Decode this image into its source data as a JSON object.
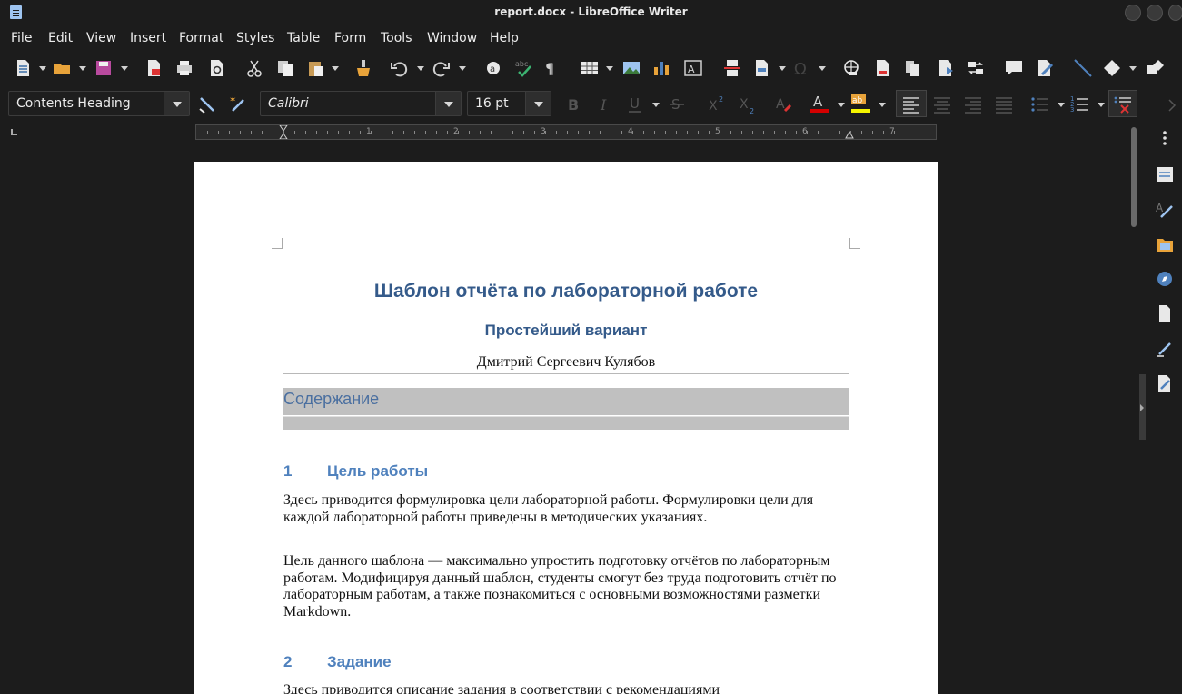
{
  "window": {
    "title": "report.docx - LibreOffice Writer"
  },
  "menu": [
    "File",
    "Edit",
    "View",
    "Insert",
    "Format",
    "Styles",
    "Table",
    "Form",
    "Tools",
    "Window",
    "Help"
  ],
  "toolbar": {
    "paragraph_style": "Contents Heading",
    "font_name": "Calibri",
    "font_size": "16 pt"
  },
  "ruler": {
    "numbers": [
      "1",
      "2",
      "3",
      "4",
      "5",
      "6",
      "7"
    ]
  },
  "document": {
    "title": "Шаблон отчёта по лабораторной работе",
    "subtitle": "Простейший вариант",
    "author": "Дмитрий Сергеевич Кулябов",
    "toc_heading": "Содержание",
    "sections": [
      {
        "number": "1",
        "heading": "Цель работы",
        "paragraphs": [
          "Здесь приводится формулировка цели лабораторной работы. Формулировки цели для каждой лабораторной работы приведены в методических указаниях.",
          "Цель данного шаблона — максимально упростить подготовку отчётов по лабораторным работам. Модифицируя данный шаблон, студенты смогут без труда подготовить отчёт по лабораторным работам, а также познакомиться с основными возможностями разметки Markdown."
        ]
      },
      {
        "number": "2",
        "heading": "Задание",
        "paragraphs": [
          "Здесь приводится описание задания в соответствии с рекомендациями"
        ]
      }
    ]
  },
  "colors": {
    "heading": "#345a8a",
    "section_heading": "#4f81bd",
    "toc_highlight": "#c0c0c0",
    "chrome": "#1c1c1c"
  }
}
